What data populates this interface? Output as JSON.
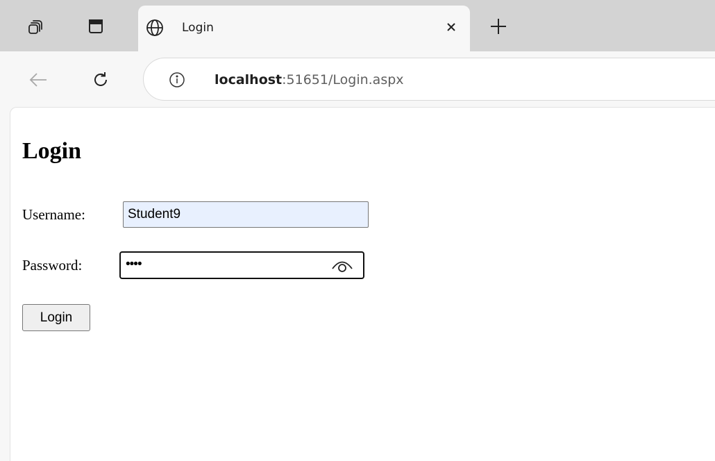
{
  "browser": {
    "tab": {
      "title": "Login"
    },
    "address_bar": {
      "url_host": "localhost",
      "url_rest": ":51651/Login.aspx"
    },
    "icons": {
      "workspaces": "workspaces-icon",
      "tab_actions": "tab-actions-icon",
      "favicon": "globe-icon",
      "close_tab": "close-icon",
      "new_tab": "plus-icon",
      "back": "back-arrow-icon",
      "refresh": "refresh-icon",
      "site_info": "info-icon",
      "reveal_password": "eye-icon"
    }
  },
  "page": {
    "heading": "Login",
    "username": {
      "label": "Username:",
      "value": "Student9"
    },
    "password": {
      "label": "Password:",
      "masked_value": "••••"
    },
    "submit_label": "Login"
  },
  "colors": {
    "autofill_background": "#e8f0fe",
    "tabstrip": "#d3d3d3"
  }
}
